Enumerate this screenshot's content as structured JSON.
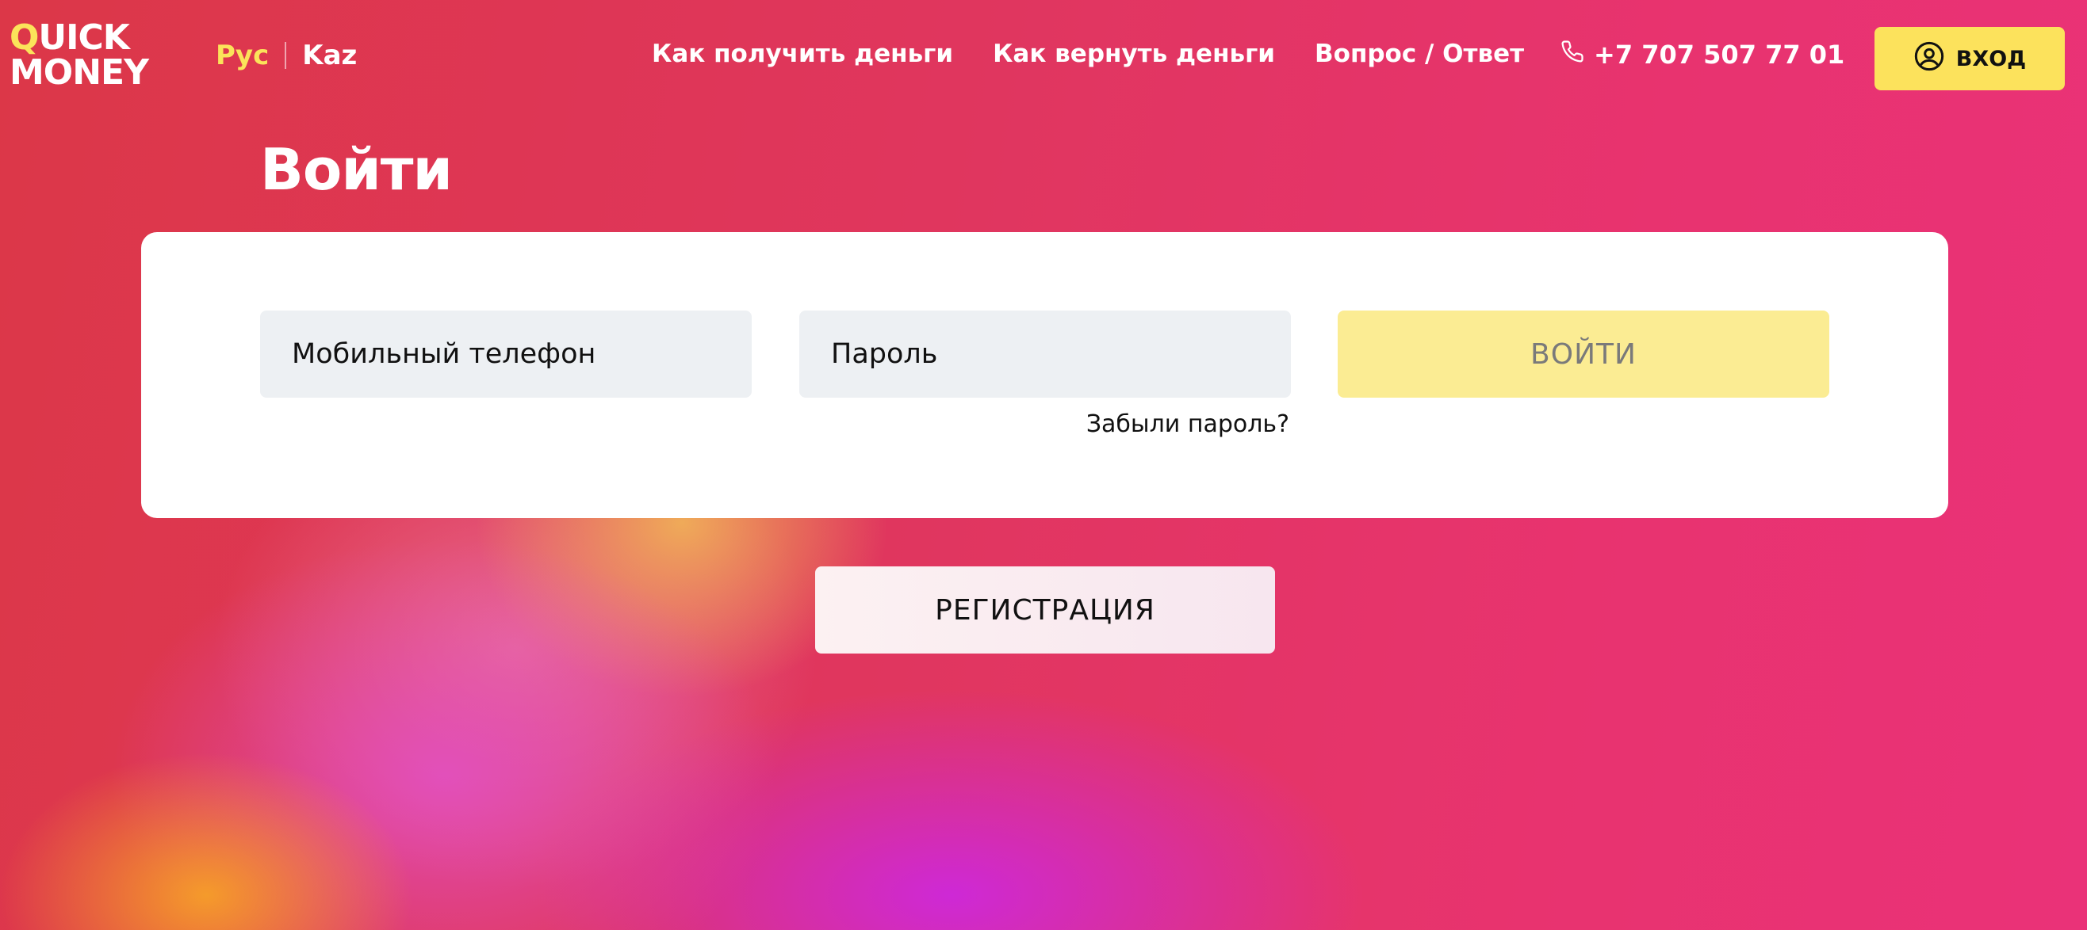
{
  "header": {
    "logo": {
      "line1_first": "Q",
      "line1_rest": "UICK",
      "line2": "MONEY"
    },
    "languages": {
      "active": "Рус",
      "other": "Kaz"
    },
    "nav": [
      "Как получить деньги",
      "Как вернуть деньги",
      "Вопрос / Ответ"
    ],
    "phone": "+7 707 507 77 01",
    "login_label": "ВХОД"
  },
  "page": {
    "title": "Войти"
  },
  "form": {
    "phone_placeholder": "Мобильный телефон",
    "password_placeholder": "Пароль",
    "submit_label": "ВОЙТИ",
    "forgot_label": "Забыли пароль?"
  },
  "register_label": "РЕГИСТРАЦИЯ",
  "colors": {
    "accent": "#fce25c",
    "submit_disabled": "#fbec93",
    "field_bg": "#edf0f3"
  },
  "icons": {
    "phone": "phone-icon",
    "user": "user-circle-icon"
  }
}
